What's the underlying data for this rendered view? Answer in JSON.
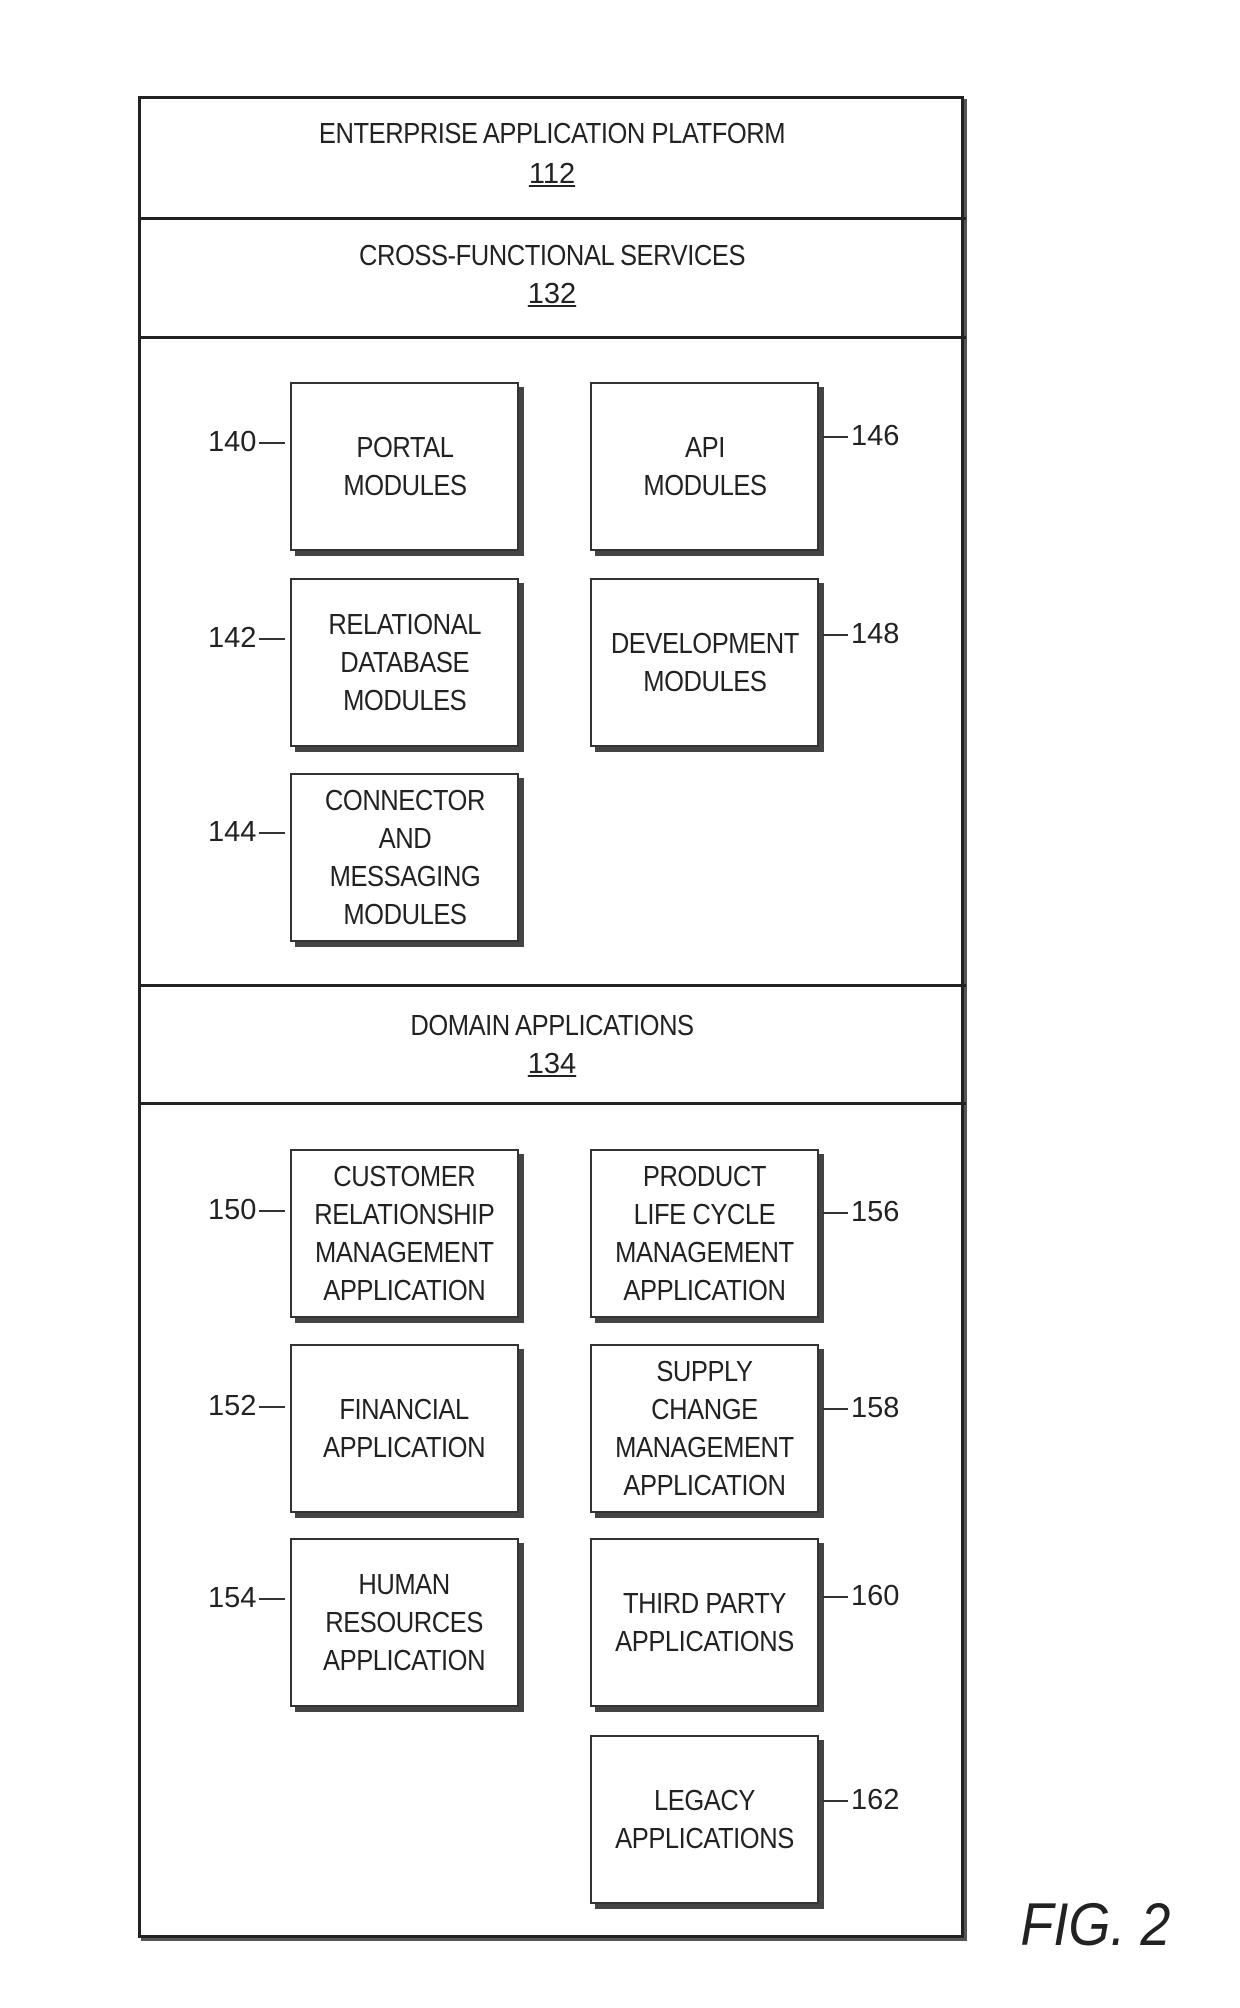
{
  "figure": {
    "label": "FIG. 2"
  },
  "platform": {
    "title": "ENTERPRISE APPLICATION PLATFORM",
    "ref": "112"
  },
  "cross_functional": {
    "title": "CROSS-FUNCTIONAL SERVICES",
    "ref": "132",
    "modules": [
      {
        "label": "PORTAL\nMODULES",
        "ref": "140"
      },
      {
        "label": "RELATIONAL\nDATABASE\nMODULES",
        "ref": "142"
      },
      {
        "label": "CONNECTOR\nAND\nMESSAGING\nMODULES",
        "ref": "144"
      },
      {
        "label": "API\nMODULES",
        "ref": "146"
      },
      {
        "label": "DEVELOPMENT\nMODULES",
        "ref": "148"
      }
    ]
  },
  "domain": {
    "title": "DOMAIN APPLICATIONS",
    "ref": "134",
    "applications": [
      {
        "label": "CUSTOMER\nRELATIONSHIP\nMANAGEMENT\nAPPLICATION",
        "ref": "150"
      },
      {
        "label": "FINANCIAL\nAPPLICATION",
        "ref": "152"
      },
      {
        "label": "HUMAN\nRESOURCES\nAPPLICATION",
        "ref": "154"
      },
      {
        "label": "PRODUCT\nLIFE CYCLE\nMANAGEMENT\nAPPLICATION",
        "ref": "156"
      },
      {
        "label": "SUPPLY\nCHANGE\nMANAGEMENT\nAPPLICATION",
        "ref": "158"
      },
      {
        "label": "THIRD PARTY\nAPPLICATIONS",
        "ref": "160"
      },
      {
        "label": "LEGACY\nAPPLICATIONS",
        "ref": "162"
      }
    ]
  }
}
